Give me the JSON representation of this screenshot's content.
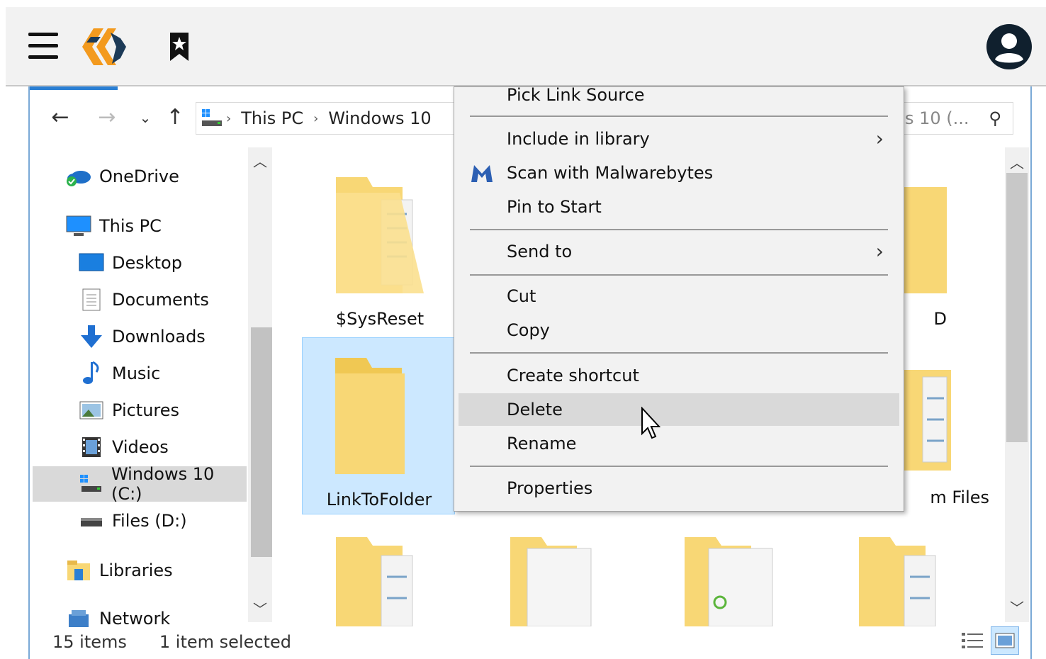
{
  "topbar": {
    "menu_icon": "hamburger-icon",
    "logo_icon": "app-logo",
    "bookmark_icon": "bookmark-star-icon",
    "account_icon": "account-circle-icon"
  },
  "navigation": {
    "back": "←",
    "forward": "→",
    "recent": "⌄",
    "up": "↑",
    "breadcrumbs": [
      "This PC",
      "Windows 10"
    ],
    "search_placeholder": "Search Windows 10 (..."
  },
  "search_visible_text": "s 10 (...",
  "sidebar": {
    "items": [
      {
        "label": "OneDrive",
        "icon": "onedrive-icon"
      },
      {
        "label": "This PC",
        "icon": "this-pc-icon"
      },
      {
        "label": "Desktop",
        "icon": "desktop-icon"
      },
      {
        "label": "Documents",
        "icon": "documents-icon"
      },
      {
        "label": "Downloads",
        "icon": "downloads-icon"
      },
      {
        "label": "Music",
        "icon": "music-icon"
      },
      {
        "label": "Pictures",
        "icon": "pictures-icon"
      },
      {
        "label": "Videos",
        "icon": "videos-icon"
      },
      {
        "label": "Windows 10 (C:)",
        "icon": "drive-c-icon",
        "selected": true
      },
      {
        "label": "Files (D:)",
        "icon": "drive-d-icon"
      },
      {
        "label": "Libraries",
        "icon": "libraries-icon"
      },
      {
        "label": "Network",
        "icon": "network-icon"
      }
    ]
  },
  "files": {
    "items": [
      {
        "name": "$SysReset"
      },
      {
        "name": "LinkToFolder",
        "selected": true
      },
      {
        "name": "D"
      },
      {
        "name": "m Files"
      }
    ]
  },
  "context_menu": {
    "items": [
      {
        "label": "Pick Link Source"
      },
      {
        "label": "Include in library",
        "submenu": true
      },
      {
        "label": "Scan with Malwarebytes",
        "icon": "malwarebytes-icon"
      },
      {
        "label": "Pin to Start"
      },
      {
        "label": "Send to",
        "submenu": true
      },
      {
        "label": "Cut"
      },
      {
        "label": "Copy"
      },
      {
        "label": "Create shortcut"
      },
      {
        "label": "Delete",
        "highlighted": true
      },
      {
        "label": "Rename"
      },
      {
        "label": "Properties"
      }
    ],
    "submenu_arrow": "›"
  },
  "status": {
    "count": "15 items",
    "selection": "1 item selected"
  },
  "colors": {
    "accent": "#2a7fd4",
    "selection_bg": "#cce8ff",
    "menu_bg": "#f2f2f2",
    "menu_highlight": "#d9d9d9",
    "folder_yellow": "#f8d775"
  }
}
